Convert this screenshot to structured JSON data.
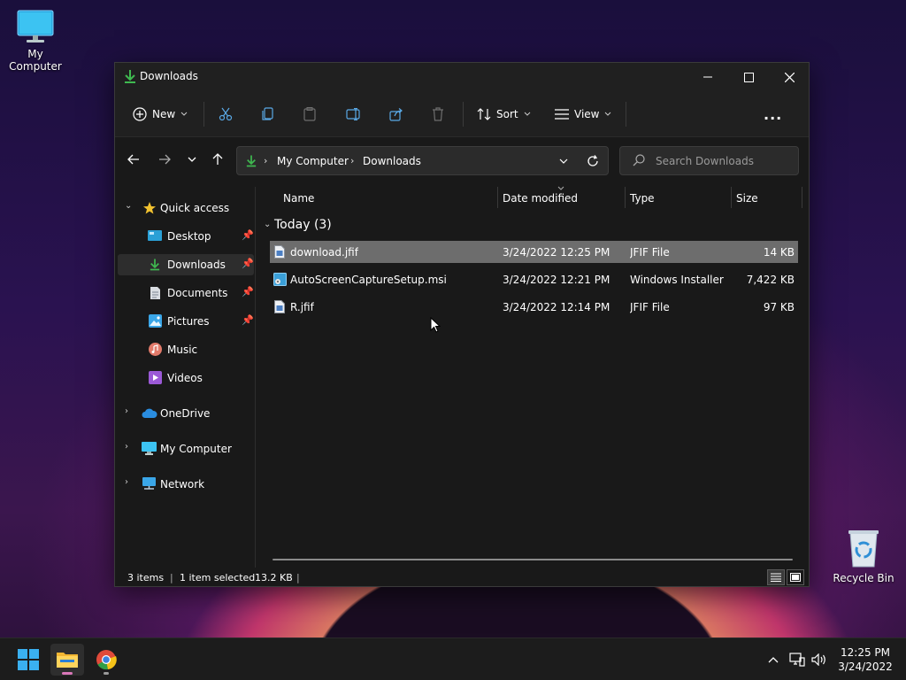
{
  "desktop": {
    "icons": [
      {
        "label": "My Computer",
        "icon": "monitor-icon"
      },
      {
        "label": "Recycle Bin",
        "icon": "recycle-bin-icon"
      }
    ]
  },
  "window": {
    "title": "Downloads",
    "toolbar": {
      "new_label": "New",
      "sort_label": "Sort",
      "view_label": "View",
      "more_label": "..."
    },
    "address": {
      "segments": [
        "My Computer",
        "Downloads"
      ]
    },
    "search": {
      "placeholder": "Search Downloads"
    },
    "sidebar": {
      "quick_access": "Quick access",
      "items": [
        {
          "label": "Desktop",
          "pinned": true
        },
        {
          "label": "Downloads",
          "pinned": true,
          "selected": true
        },
        {
          "label": "Documents",
          "pinned": true
        },
        {
          "label": "Pictures",
          "pinned": true
        },
        {
          "label": "Music",
          "pinned": false
        },
        {
          "label": "Videos",
          "pinned": false
        }
      ],
      "onedrive": "OneDrive",
      "my_computer": "My Computer",
      "network": "Network"
    },
    "columns": {
      "name": "Name",
      "date": "Date modified",
      "type": "Type",
      "size": "Size"
    },
    "group_label": "Today (3)",
    "files": [
      {
        "name": "download.jfif",
        "date": "3/24/2022 12:25 PM",
        "type": "JFIF File",
        "size": "14 KB",
        "selected": true
      },
      {
        "name": "AutoScreenCaptureSetup.msi",
        "date": "3/24/2022 12:21 PM",
        "type": "Windows Installer ...",
        "size": "7,422 KB",
        "selected": false
      },
      {
        "name": "R.jfif",
        "date": "3/24/2022 12:14 PM",
        "type": "JFIF File",
        "size": "97 KB",
        "selected": false
      }
    ],
    "status": {
      "items": "3 items",
      "selected": "1 item selected",
      "size": "13.2 KB",
      "sep": "|"
    }
  },
  "taskbar": {
    "clock_time": "12:25 PM",
    "clock_date": "3/24/2022"
  },
  "colors": {
    "accent_green": "#3fb950",
    "selection": "#6d6d6d",
    "window_bg": "#191919"
  }
}
